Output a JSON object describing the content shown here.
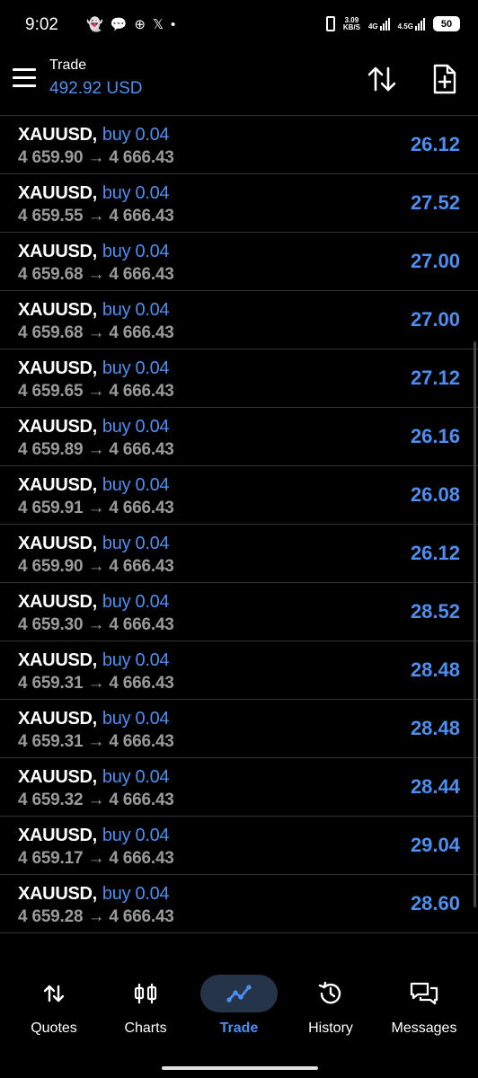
{
  "status": {
    "time": "9:02",
    "net_speed_top": "3.09",
    "net_speed_bottom": "KB/S",
    "net1": "4G",
    "net2": "4.5G",
    "battery": "50"
  },
  "header": {
    "title": "Trade",
    "balance": "492.92 USD"
  },
  "positions": [
    {
      "symbol": "XAUUSD",
      "side": "buy 0.04",
      "prices": "4 659.90 → 4 666.43",
      "profit": "26.12"
    },
    {
      "symbol": "XAUUSD",
      "side": "buy 0.04",
      "prices": "4 659.55 → 4 666.43",
      "profit": "27.52"
    },
    {
      "symbol": "XAUUSD",
      "side": "buy 0.04",
      "prices": "4 659.68 → 4 666.43",
      "profit": "27.00"
    },
    {
      "symbol": "XAUUSD",
      "side": "buy 0.04",
      "prices": "4 659.68 → 4 666.43",
      "profit": "27.00"
    },
    {
      "symbol": "XAUUSD",
      "side": "buy 0.04",
      "prices": "4 659.65 → 4 666.43",
      "profit": "27.12"
    },
    {
      "symbol": "XAUUSD",
      "side": "buy 0.04",
      "prices": "4 659.89 → 4 666.43",
      "profit": "26.16"
    },
    {
      "symbol": "XAUUSD",
      "side": "buy 0.04",
      "prices": "4 659.91 → 4 666.43",
      "profit": "26.08"
    },
    {
      "symbol": "XAUUSD",
      "side": "buy 0.04",
      "prices": "4 659.90 → 4 666.43",
      "profit": "26.12"
    },
    {
      "symbol": "XAUUSD",
      "side": "buy 0.04",
      "prices": "4 659.30 → 4 666.43",
      "profit": "28.52"
    },
    {
      "symbol": "XAUUSD",
      "side": "buy 0.04",
      "prices": "4 659.31 → 4 666.43",
      "profit": "28.48"
    },
    {
      "symbol": "XAUUSD",
      "side": "buy 0.04",
      "prices": "4 659.31 → 4 666.43",
      "profit": "28.48"
    },
    {
      "symbol": "XAUUSD",
      "side": "buy 0.04",
      "prices": "4 659.32 → 4 666.43",
      "profit": "28.44"
    },
    {
      "symbol": "XAUUSD",
      "side": "buy 0.04",
      "prices": "4 659.17 → 4 666.43",
      "profit": "29.04"
    },
    {
      "symbol": "XAUUSD",
      "side": "buy 0.04",
      "prices": "4 659.28 → 4 666.43",
      "profit": "28.60"
    }
  ],
  "nav": [
    {
      "label": "Quotes",
      "icon": "quotes-icon",
      "active": false
    },
    {
      "label": "Charts",
      "icon": "charts-icon",
      "active": false
    },
    {
      "label": "Trade",
      "icon": "trade-icon",
      "active": true
    },
    {
      "label": "History",
      "icon": "history-icon",
      "active": false
    },
    {
      "label": "Messages",
      "icon": "messages-icon",
      "active": false
    }
  ],
  "colors": {
    "accent": "#4d8ff0",
    "background": "#000000",
    "price_text": "#9a9a9a",
    "nav_active_bg": "#26344a"
  }
}
